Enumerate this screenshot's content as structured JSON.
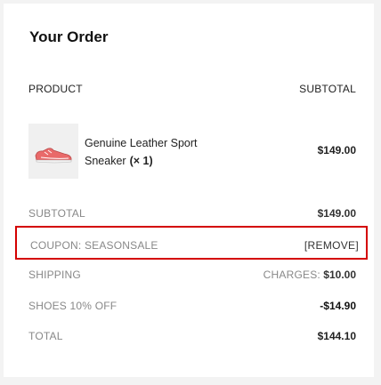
{
  "order": {
    "title": "Your Order",
    "header": {
      "product": "PRODUCT",
      "subtotal": "SUBTOTAL"
    },
    "item": {
      "name": "Genuine Leather Sport Sneaker",
      "qty": "(× 1)",
      "price": "$149.00",
      "icon": "sneaker-image"
    },
    "subtotal": {
      "label": "SUBTOTAL",
      "value": "$149.00"
    },
    "coupon": {
      "label": "COUPON: SEASONSALE",
      "remove": "[REMOVE]",
      "highlight_color": "#d40000"
    },
    "shipping": {
      "label": "SHIPPING",
      "charges_label": "CHARGES:",
      "value": "$10.00"
    },
    "discount": {
      "label": "SHOES 10% OFF",
      "value": "-$14.90"
    },
    "total": {
      "label": "TOTAL",
      "value": "$144.10"
    }
  }
}
